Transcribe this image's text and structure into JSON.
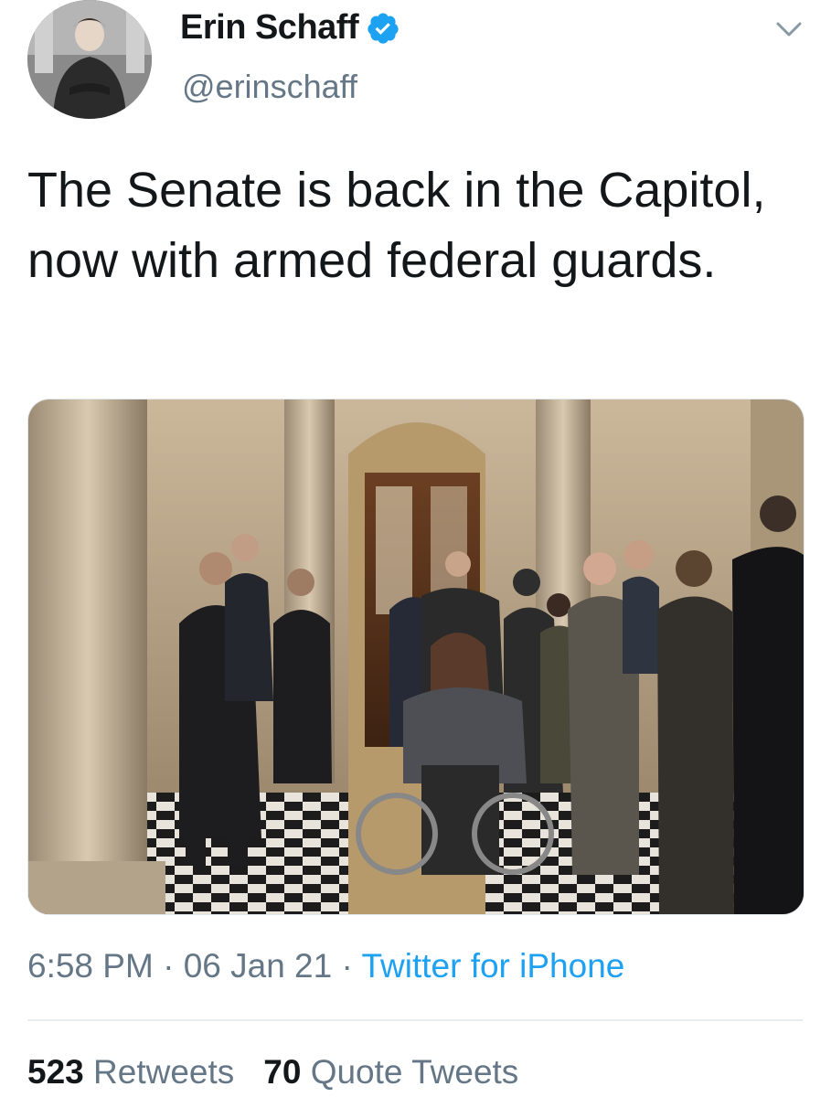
{
  "user": {
    "display_name": "Erin Schaff",
    "handle": "@erinschaff",
    "verified_icon": "verified-badge-icon",
    "menu_icon": "chevron-down-icon"
  },
  "tweet": {
    "text": "The Senate is back in the Capitol, now with armed federal guards.",
    "time": "6:58 PM",
    "date": "06 Jan 21",
    "separator": "·",
    "source": "Twitter for iPhone"
  },
  "stats": {
    "retweets_count": "523",
    "retweets_label": "Retweets",
    "quotes_count": "70",
    "quotes_label": "Quote Tweets"
  },
  "colors": {
    "accent": "#1da1f2",
    "text": "#14171a",
    "secondary": "#657786"
  }
}
